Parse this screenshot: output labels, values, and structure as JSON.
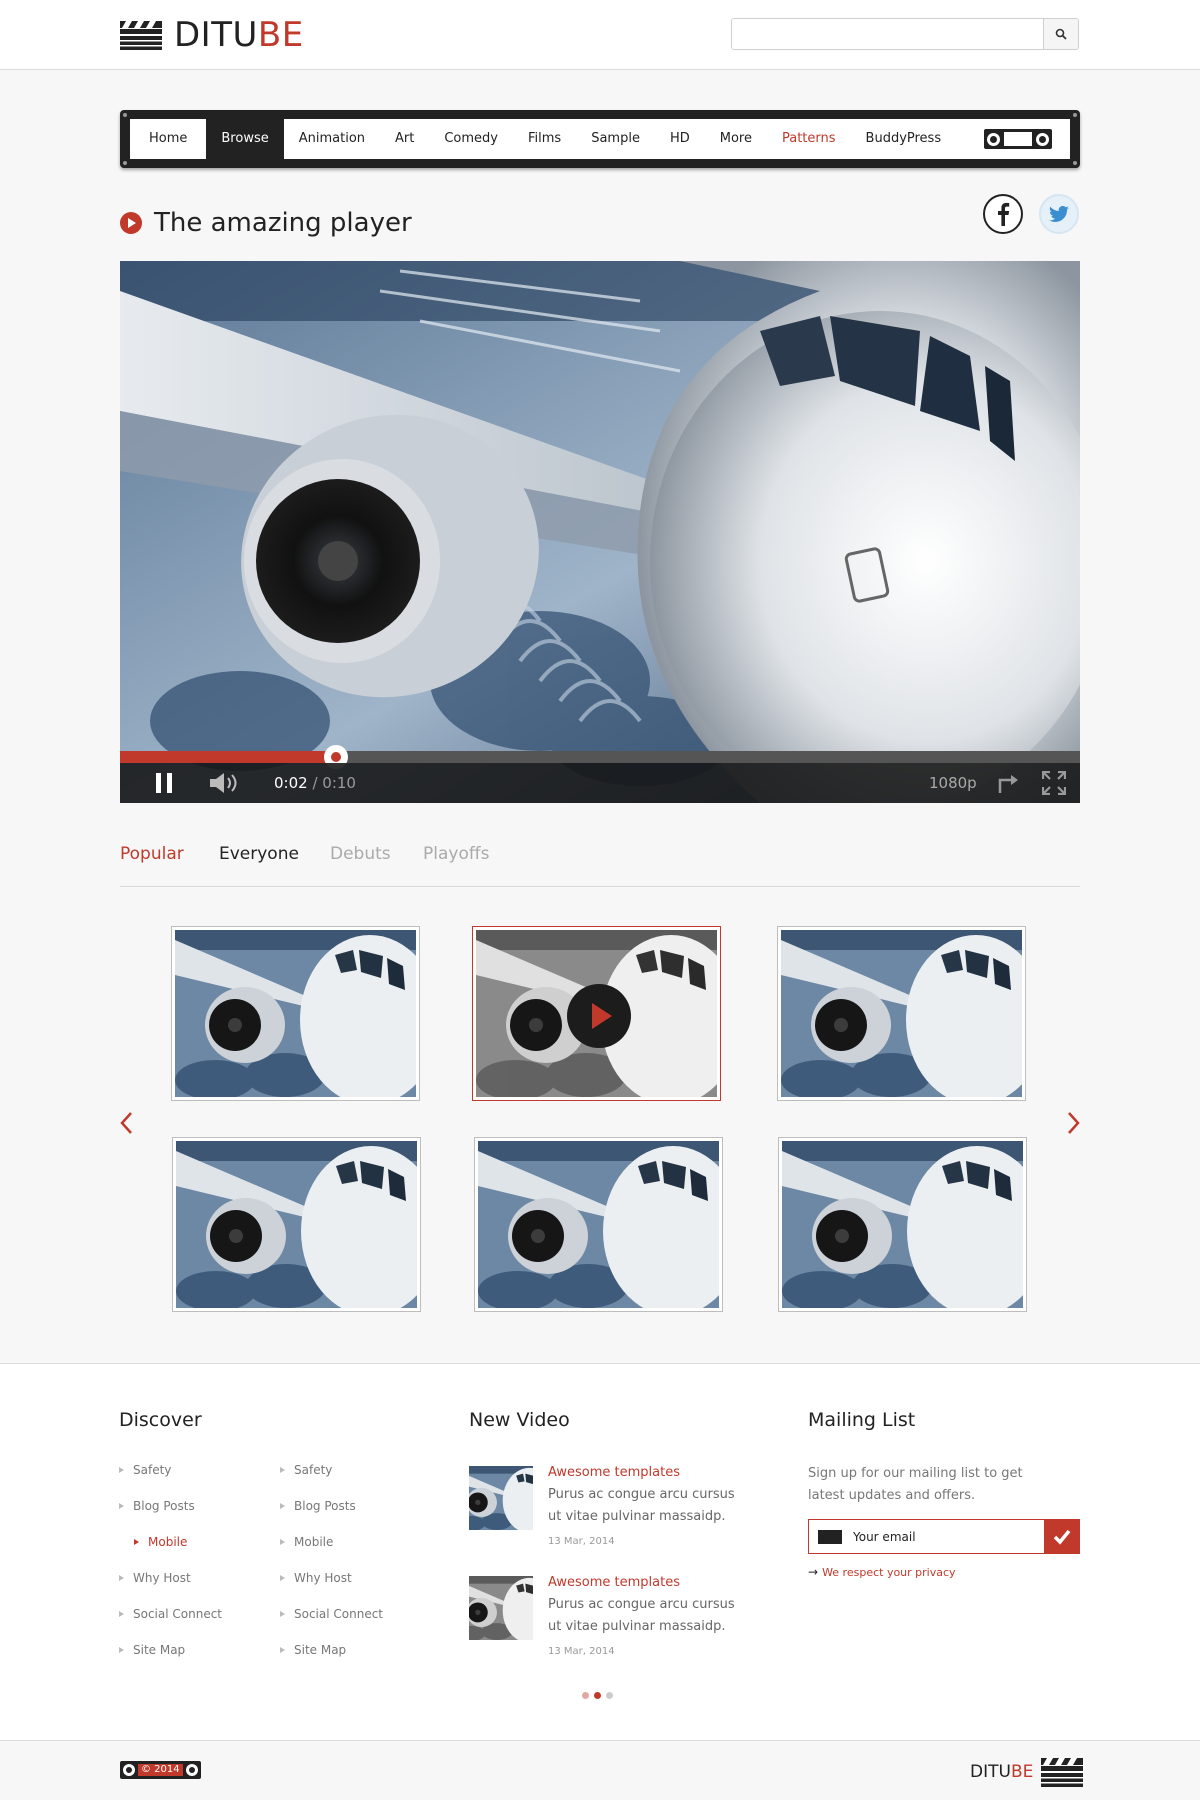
{
  "header": {
    "logo": {
      "part1": "DITU",
      "part2": "BE"
    },
    "search": {
      "placeholder": "",
      "value": ""
    }
  },
  "nav": {
    "items": [
      {
        "label": "Home"
      },
      {
        "label": "Browse",
        "active": true
      },
      {
        "label": "Animation"
      },
      {
        "label": "Art"
      },
      {
        "label": "Comedy"
      },
      {
        "label": "Films"
      },
      {
        "label": "Sample"
      },
      {
        "label": "HD"
      },
      {
        "label": "More"
      },
      {
        "label": "Patterns",
        "accent": true
      },
      {
        "label": "BuddyPress"
      }
    ]
  },
  "player": {
    "title": "The amazing player",
    "current_time": "0:02",
    "duration": "/ 0:10",
    "quality": "1080p",
    "progress": 0.225
  },
  "tabs": [
    "Popular",
    "Everyone",
    "Debuts",
    "Playoffs"
  ],
  "discover": {
    "title": "Discover",
    "column1": [
      "Safety",
      "Blog Posts",
      "Mobile",
      "Why Host",
      "Social Connect",
      "Site Map"
    ],
    "column2": [
      "Safety",
      "Blog Posts",
      "Mobile",
      "Why Host",
      "Social Connect",
      "Site Map"
    ]
  },
  "new_video": {
    "title": "New Video",
    "items": [
      {
        "title": "Awesome templates",
        "desc": "Purus ac congue arcu cursus ut vitae pulvinar massaidp.",
        "date": "13 Mar, 2014"
      },
      {
        "title": "Awesome templates",
        "desc": "Purus ac congue arcu cursus ut vitae pulvinar massaidp.",
        "date": "13 Mar, 2014"
      }
    ]
  },
  "mailing": {
    "title": "Mailing List",
    "text": "Sign up for our mailing list to get latest updates and offers.",
    "placeholder": "Your email",
    "privacy": "We respect your privacy"
  },
  "footer": {
    "copyright": "© 2014",
    "logo": {
      "part1": "DITU",
      "part2": "BE"
    }
  },
  "colors": {
    "accent": "#c0392b",
    "dark": "#222222"
  },
  "icons": [
    "clapperboard-icon",
    "search-icon",
    "reel-icon",
    "play-circle-icon",
    "facebook-icon",
    "twitter-icon",
    "pause-icon",
    "volume-icon",
    "share-icon",
    "fullscreen-icon",
    "chevron-left-icon",
    "chevron-right-icon",
    "envelope-icon",
    "checkmark-icon"
  ]
}
